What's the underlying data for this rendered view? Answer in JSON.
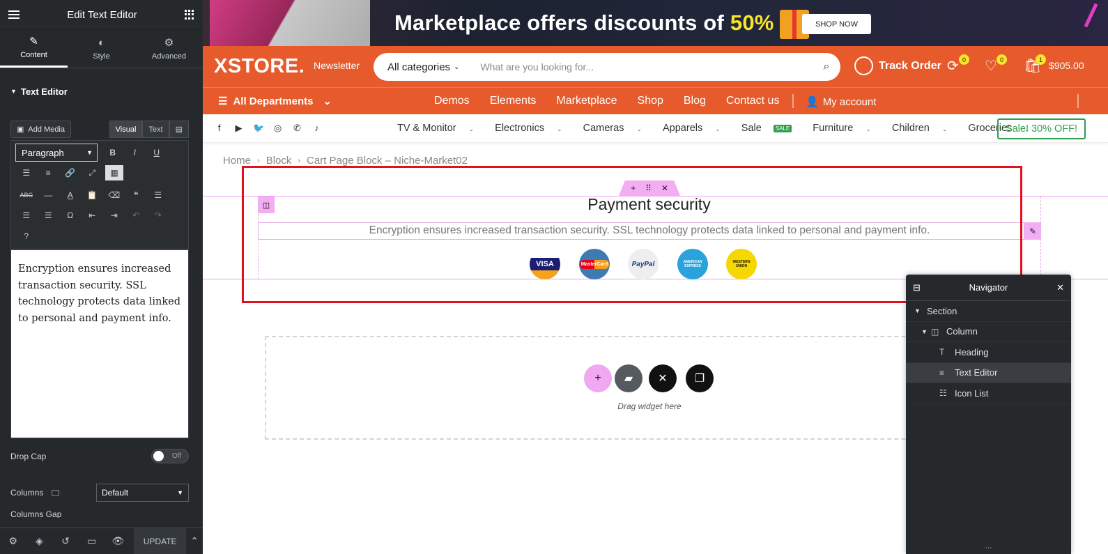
{
  "panel": {
    "title": "Edit Text Editor",
    "tabs": [
      {
        "label": "Content",
        "icon": "pencil-icon"
      },
      {
        "label": "Style",
        "icon": "half-circle-icon"
      },
      {
        "label": "Advanced",
        "icon": "gear-icon"
      }
    ],
    "section_title": "Text Editor",
    "add_media_label": "Add Media",
    "visual_tab": "Visual",
    "text_tab": "Text",
    "format_select": "Paragraph",
    "editor_text": "Encryption ensures increased transaction security. SSL technology protects data linked to personal and payment info.",
    "drop_cap_label": "Drop Cap",
    "drop_cap_state": "Off",
    "columns_label": "Columns",
    "columns_value": "Default",
    "column_gap_label": "Columns Gap",
    "update_label": "UPDATE"
  },
  "promo": {
    "text": "Marketplace offers discounts of",
    "percent": "50%",
    "shop_now": "SHOP NOW"
  },
  "header": {
    "logo": "XSTORE.",
    "newsletter": "Newsletter",
    "category": "All categories",
    "search_placeholder": "What are you looking for...",
    "track_order": "Track Order",
    "compare_count": "0",
    "wishlist_count": "0",
    "cart_count": "1",
    "cart_total": "$905.00"
  },
  "nav": {
    "all_departments": "All Departments",
    "links": [
      "Demos",
      "Elements",
      "Marketplace",
      "Shop",
      "Blog",
      "Contact us"
    ],
    "my_account": "My account"
  },
  "catbar": {
    "categories": [
      "TV & Monitor",
      "Electronics",
      "Cameras",
      "Apparels",
      "Sale",
      "Furniture",
      "Children",
      "Groceries"
    ],
    "sale_badge": "SALE",
    "sale_button": "Sale! 30% OFF!"
  },
  "breadcrumb": {
    "items": [
      "Home",
      "Block",
      "Cart Page Block – Niche-Market02"
    ]
  },
  "content": {
    "heading": "Payment security",
    "text": "Encryption ensures increased transaction security. SSL technology protects data linked to personal and payment info.",
    "payment_logos": [
      "VISA",
      "MasterCard",
      "PayPal",
      "AMERICAN EXPRESS",
      "WESTERN UNION"
    ],
    "drag_text": "Drag widget here"
  },
  "navigator": {
    "title": "Navigator",
    "items": [
      {
        "label": "Section",
        "level": 0
      },
      {
        "label": "Column",
        "level": 1
      },
      {
        "label": "Heading",
        "level": 2
      },
      {
        "label": "Text Editor",
        "level": 2
      },
      {
        "label": "Icon List",
        "level": 2
      }
    ]
  },
  "colors": {
    "brand_orange": "#e65a2c",
    "panel_dark": "#26292c",
    "accent_pink": "#f3aef3",
    "sale_green": "#2e9f4c",
    "highlight_red": "#e2111c"
  }
}
